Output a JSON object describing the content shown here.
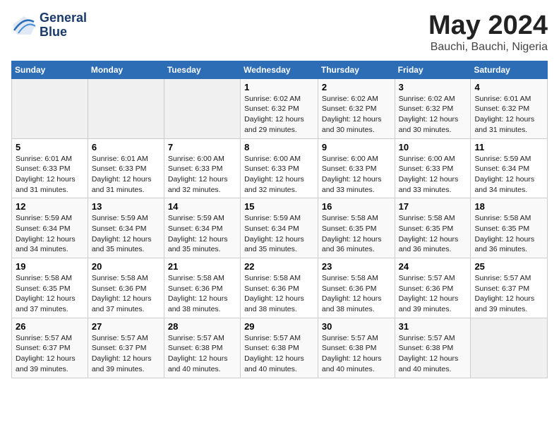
{
  "header": {
    "logo_line1": "General",
    "logo_line2": "Blue",
    "title": "May 2024",
    "subtitle": "Bauchi, Bauchi, Nigeria"
  },
  "weekdays": [
    "Sunday",
    "Monday",
    "Tuesday",
    "Wednesday",
    "Thursday",
    "Friday",
    "Saturday"
  ],
  "weeks": [
    [
      {
        "day": "",
        "info": ""
      },
      {
        "day": "",
        "info": ""
      },
      {
        "day": "",
        "info": ""
      },
      {
        "day": "1",
        "info": "Sunrise: 6:02 AM\nSunset: 6:32 PM\nDaylight: 12 hours and 29 minutes."
      },
      {
        "day": "2",
        "info": "Sunrise: 6:02 AM\nSunset: 6:32 PM\nDaylight: 12 hours and 30 minutes."
      },
      {
        "day": "3",
        "info": "Sunrise: 6:02 AM\nSunset: 6:32 PM\nDaylight: 12 hours and 30 minutes."
      },
      {
        "day": "4",
        "info": "Sunrise: 6:01 AM\nSunset: 6:32 PM\nDaylight: 12 hours and 31 minutes."
      }
    ],
    [
      {
        "day": "5",
        "info": "Sunrise: 6:01 AM\nSunset: 6:33 PM\nDaylight: 12 hours and 31 minutes."
      },
      {
        "day": "6",
        "info": "Sunrise: 6:01 AM\nSunset: 6:33 PM\nDaylight: 12 hours and 31 minutes."
      },
      {
        "day": "7",
        "info": "Sunrise: 6:00 AM\nSunset: 6:33 PM\nDaylight: 12 hours and 32 minutes."
      },
      {
        "day": "8",
        "info": "Sunrise: 6:00 AM\nSunset: 6:33 PM\nDaylight: 12 hours and 32 minutes."
      },
      {
        "day": "9",
        "info": "Sunrise: 6:00 AM\nSunset: 6:33 PM\nDaylight: 12 hours and 33 minutes."
      },
      {
        "day": "10",
        "info": "Sunrise: 6:00 AM\nSunset: 6:33 PM\nDaylight: 12 hours and 33 minutes."
      },
      {
        "day": "11",
        "info": "Sunrise: 5:59 AM\nSunset: 6:34 PM\nDaylight: 12 hours and 34 minutes."
      }
    ],
    [
      {
        "day": "12",
        "info": "Sunrise: 5:59 AM\nSunset: 6:34 PM\nDaylight: 12 hours and 34 minutes."
      },
      {
        "day": "13",
        "info": "Sunrise: 5:59 AM\nSunset: 6:34 PM\nDaylight: 12 hours and 35 minutes."
      },
      {
        "day": "14",
        "info": "Sunrise: 5:59 AM\nSunset: 6:34 PM\nDaylight: 12 hours and 35 minutes."
      },
      {
        "day": "15",
        "info": "Sunrise: 5:59 AM\nSunset: 6:34 PM\nDaylight: 12 hours and 35 minutes."
      },
      {
        "day": "16",
        "info": "Sunrise: 5:58 AM\nSunset: 6:35 PM\nDaylight: 12 hours and 36 minutes."
      },
      {
        "day": "17",
        "info": "Sunrise: 5:58 AM\nSunset: 6:35 PM\nDaylight: 12 hours and 36 minutes."
      },
      {
        "day": "18",
        "info": "Sunrise: 5:58 AM\nSunset: 6:35 PM\nDaylight: 12 hours and 36 minutes."
      }
    ],
    [
      {
        "day": "19",
        "info": "Sunrise: 5:58 AM\nSunset: 6:35 PM\nDaylight: 12 hours and 37 minutes."
      },
      {
        "day": "20",
        "info": "Sunrise: 5:58 AM\nSunset: 6:36 PM\nDaylight: 12 hours and 37 minutes."
      },
      {
        "day": "21",
        "info": "Sunrise: 5:58 AM\nSunset: 6:36 PM\nDaylight: 12 hours and 38 minutes."
      },
      {
        "day": "22",
        "info": "Sunrise: 5:58 AM\nSunset: 6:36 PM\nDaylight: 12 hours and 38 minutes."
      },
      {
        "day": "23",
        "info": "Sunrise: 5:58 AM\nSunset: 6:36 PM\nDaylight: 12 hours and 38 minutes."
      },
      {
        "day": "24",
        "info": "Sunrise: 5:57 AM\nSunset: 6:36 PM\nDaylight: 12 hours and 39 minutes."
      },
      {
        "day": "25",
        "info": "Sunrise: 5:57 AM\nSunset: 6:37 PM\nDaylight: 12 hours and 39 minutes."
      }
    ],
    [
      {
        "day": "26",
        "info": "Sunrise: 5:57 AM\nSunset: 6:37 PM\nDaylight: 12 hours and 39 minutes."
      },
      {
        "day": "27",
        "info": "Sunrise: 5:57 AM\nSunset: 6:37 PM\nDaylight: 12 hours and 39 minutes."
      },
      {
        "day": "28",
        "info": "Sunrise: 5:57 AM\nSunset: 6:38 PM\nDaylight: 12 hours and 40 minutes."
      },
      {
        "day": "29",
        "info": "Sunrise: 5:57 AM\nSunset: 6:38 PM\nDaylight: 12 hours and 40 minutes."
      },
      {
        "day": "30",
        "info": "Sunrise: 5:57 AM\nSunset: 6:38 PM\nDaylight: 12 hours and 40 minutes."
      },
      {
        "day": "31",
        "info": "Sunrise: 5:57 AM\nSunset: 6:38 PM\nDaylight: 12 hours and 40 minutes."
      },
      {
        "day": "",
        "info": ""
      }
    ]
  ]
}
